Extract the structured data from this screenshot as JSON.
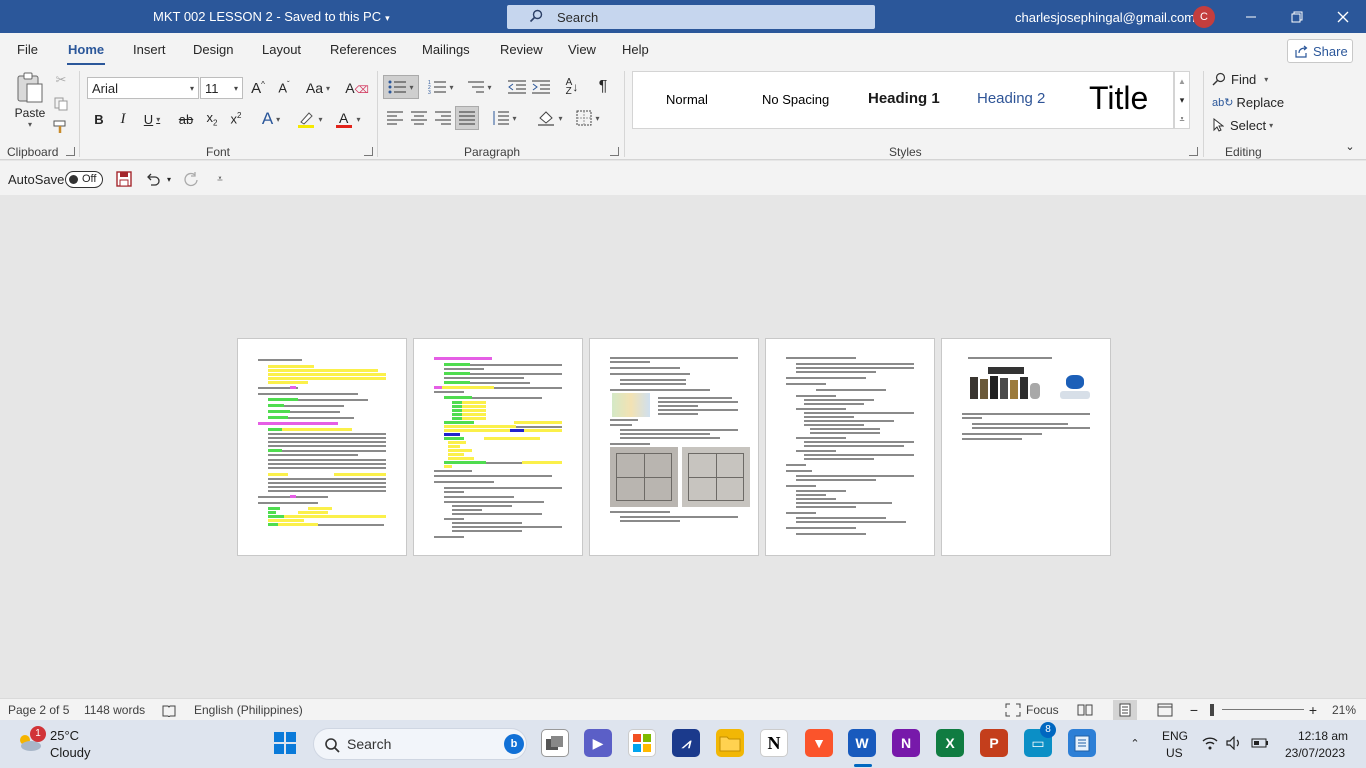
{
  "window": {
    "doc_title": "MKT 002 LESSON 2  -  Saved to this PC",
    "search_label": "Search",
    "account_email": "charlesjosephingal@gmail.com",
    "avatar_initial": "C"
  },
  "tabs": [
    {
      "label": "File"
    },
    {
      "label": "Home"
    },
    {
      "label": "Insert"
    },
    {
      "label": "Design"
    },
    {
      "label": "Layout"
    },
    {
      "label": "References"
    },
    {
      "label": "Mailings"
    },
    {
      "label": "Review"
    },
    {
      "label": "View"
    },
    {
      "label": "Help"
    }
  ],
  "share_label": "Share",
  "ribbon": {
    "clipboard": {
      "paste_label": "Paste",
      "group_label": "Clipboard"
    },
    "font": {
      "font_name": "Arial",
      "font_size": "11",
      "group_label": "Font"
    },
    "paragraph": {
      "group_label": "Paragraph"
    },
    "styles": {
      "group_label": "Styles",
      "items": [
        {
          "label": "Normal"
        },
        {
          "label": "No Spacing"
        },
        {
          "label": "Heading 1"
        },
        {
          "label": "Heading 2"
        },
        {
          "label": "Title"
        }
      ]
    },
    "editing": {
      "group_label": "Editing",
      "find_label": "Find",
      "replace_label": "Replace",
      "select_label": "Select"
    }
  },
  "qat": {
    "autosave_label": "AutoSave",
    "autosave_state": "Off"
  },
  "status": {
    "page": "Page 2 of 5",
    "words": "1148 words",
    "language": "English (Philippines)",
    "focus": "Focus",
    "zoom": "21%"
  },
  "taskbar": {
    "temperature": "25°C",
    "condition": "Cloudy",
    "weather_badge": "1",
    "search_label": "Search",
    "store_badge": "8",
    "lang_top": "ENG",
    "lang_bottom": "US",
    "time": "12:18 am",
    "date": "23/07/2023"
  }
}
